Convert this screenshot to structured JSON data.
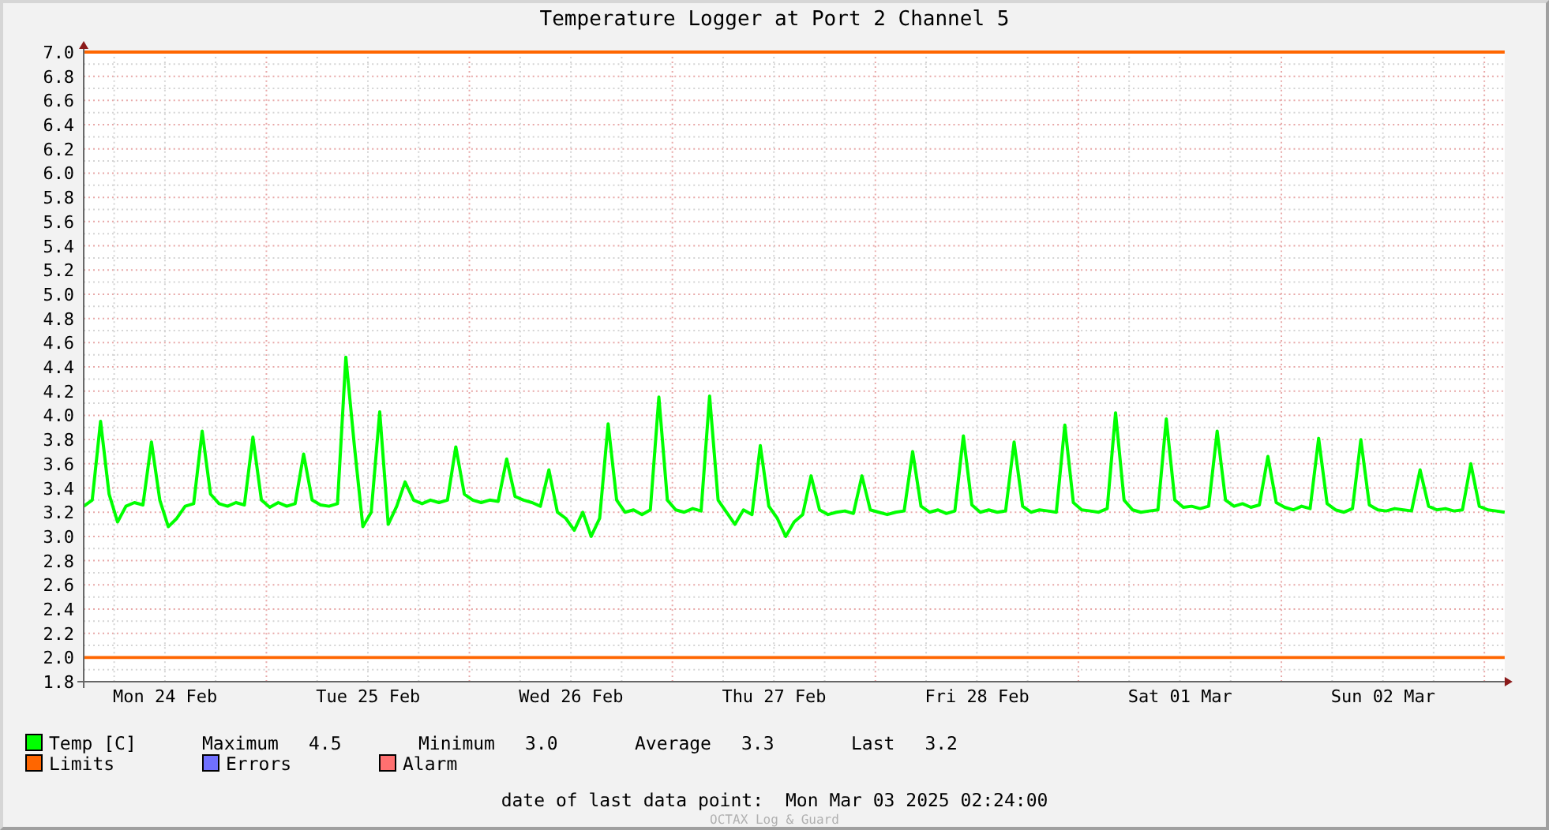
{
  "title": "Temperature Logger at Port 2 Channel 5",
  "chart_data": {
    "type": "line",
    "grid": true,
    "ylim": [
      1.8,
      7.0
    ],
    "categories": [
      null,
      null,
      null,
      null,
      null,
      null,
      null,
      null,
      null,
      null,
      "Mon 24 Feb",
      null,
      null,
      null,
      null,
      null,
      null,
      null,
      null,
      null,
      null,
      null,
      null,
      null,
      null,
      null,
      null,
      null,
      null,
      null,
      null,
      null,
      null,
      null,
      "Tue 25 Feb",
      null,
      null,
      null,
      null,
      null,
      null,
      null,
      null,
      null,
      null,
      null,
      null,
      null,
      null,
      null,
      null,
      null,
      null,
      null,
      null,
      null,
      null,
      null,
      "Wed 26 Feb",
      null,
      null,
      null,
      null,
      null,
      null,
      null,
      null,
      null,
      null,
      null,
      null,
      null,
      null,
      null,
      null,
      null,
      null,
      null,
      null,
      null,
      null,
      null,
      "Thu 27 Feb",
      null,
      null,
      null,
      null,
      null,
      null,
      null,
      null,
      null,
      null,
      null,
      null,
      null,
      null,
      null,
      null,
      null,
      null,
      null,
      null,
      null,
      null,
      null,
      "Fri 28 Feb",
      null,
      null,
      null,
      null,
      null,
      null,
      null,
      null,
      null,
      null,
      null,
      null,
      null,
      null,
      null,
      null,
      null,
      null,
      null,
      null,
      null,
      null,
      null,
      "Sat 01 Mar",
      null,
      null,
      null,
      null,
      null,
      null,
      null,
      null,
      null,
      null,
      null,
      null,
      null,
      null,
      null,
      null,
      null,
      null,
      null,
      null,
      null,
      null,
      null,
      "Sun 02 Mar",
      null,
      null,
      null,
      null,
      null,
      null,
      null,
      null,
      null,
      null,
      null,
      null,
      null,
      null
    ],
    "yticks": [
      {
        "value": 1.8,
        "label": "1.8"
      },
      {
        "value": 2.0,
        "label": "2.0"
      },
      {
        "value": 2.2,
        "label": "2.2"
      },
      {
        "value": 2.4,
        "label": "2.4"
      },
      {
        "value": 2.6,
        "label": "2.6"
      },
      {
        "value": 2.8,
        "label": "2.8"
      },
      {
        "value": 3.0,
        "label": "3.0"
      },
      {
        "value": 3.2,
        "label": "3.2"
      },
      {
        "value": 3.4,
        "label": "3.4"
      },
      {
        "value": 3.6,
        "label": "3.6"
      },
      {
        "value": 3.8,
        "label": "3.8"
      },
      {
        "value": 4.0,
        "label": "4.0"
      },
      {
        "value": 4.2,
        "label": "4.2"
      },
      {
        "value": 4.4,
        "label": "4.4"
      },
      {
        "value": 4.6,
        "label": "4.6"
      },
      {
        "value": 4.8,
        "label": "4.8"
      },
      {
        "value": 5.0,
        "label": "5.0"
      },
      {
        "value": 5.2,
        "label": "5.2"
      },
      {
        "value": 5.4,
        "label": "5.4"
      },
      {
        "value": 5.6,
        "label": "5.6"
      },
      {
        "value": 5.8,
        "label": "5.8"
      },
      {
        "value": 6.0,
        "label": "6.0"
      },
      {
        "value": 6.2,
        "label": "6.2"
      },
      {
        "value": 6.4,
        "label": "6.4"
      },
      {
        "value": 6.6,
        "label": "6.6"
      },
      {
        "value": 6.8,
        "label": "6.8"
      },
      {
        "value": 7.0,
        "label": "7.0"
      }
    ],
    "series": [
      {
        "name": "Temp [C]",
        "color": "#00ff00",
        "values": [
          3.25,
          3.3,
          3.95,
          3.35,
          3.12,
          3.25,
          3.28,
          3.26,
          3.78,
          3.3,
          3.08,
          3.15,
          3.25,
          3.27,
          3.87,
          3.35,
          3.27,
          3.25,
          3.28,
          3.26,
          3.82,
          3.3,
          3.24,
          3.28,
          3.25,
          3.27,
          3.68,
          3.3,
          3.26,
          3.25,
          3.27,
          4.48,
          3.75,
          3.08,
          3.2,
          4.03,
          3.1,
          3.25,
          3.45,
          3.3,
          3.27,
          3.3,
          3.28,
          3.3,
          3.74,
          3.35,
          3.3,
          3.28,
          3.3,
          3.29,
          3.64,
          3.33,
          3.3,
          3.28,
          3.25,
          3.55,
          3.2,
          3.15,
          3.05,
          3.2,
          3.0,
          3.15,
          3.93,
          3.3,
          3.2,
          3.22,
          3.18,
          3.22,
          4.15,
          3.3,
          3.22,
          3.2,
          3.23,
          3.21,
          4.16,
          3.3,
          3.2,
          3.1,
          3.22,
          3.18,
          3.75,
          3.25,
          3.15,
          3.0,
          3.12,
          3.18,
          3.5,
          3.22,
          3.18,
          3.2,
          3.21,
          3.19,
          3.5,
          3.22,
          3.2,
          3.18,
          3.2,
          3.21,
          3.7,
          3.25,
          3.2,
          3.22,
          3.19,
          3.21,
          3.83,
          3.26,
          3.2,
          3.22,
          3.2,
          3.21,
          3.78,
          3.25,
          3.2,
          3.22,
          3.21,
          3.2,
          3.92,
          3.28,
          3.22,
          3.21,
          3.2,
          3.23,
          4.02,
          3.3,
          3.22,
          3.2,
          3.21,
          3.22,
          3.97,
          3.3,
          3.24,
          3.25,
          3.23,
          3.25,
          3.87,
          3.3,
          3.25,
          3.27,
          3.24,
          3.26,
          3.66,
          3.28,
          3.24,
          3.22,
          3.25,
          3.23,
          3.81,
          3.27,
          3.22,
          3.2,
          3.23,
          3.8,
          3.26,
          3.22,
          3.21,
          3.23,
          3.22,
          3.21,
          3.55,
          3.25,
          3.22,
          3.23,
          3.21,
          3.22,
          3.6,
          3.25,
          3.22,
          3.21,
          3.2
        ]
      },
      {
        "name": "Limits",
        "color": "#ff6600",
        "values": [
          7,
          7,
          7,
          7,
          7,
          7,
          7,
          7,
          7,
          7,
          7,
          7,
          7,
          7,
          7,
          7,
          7,
          7,
          7,
          7,
          7,
          7,
          7,
          7,
          7,
          7,
          7,
          7,
          7,
          7,
          7,
          7,
          7,
          7,
          7,
          7,
          7,
          7,
          7,
          7,
          7,
          7,
          7,
          7,
          7,
          7,
          7,
          7,
          7,
          7,
          7,
          7,
          7,
          7,
          7,
          7,
          7,
          7,
          7,
          7,
          7,
          7,
          7,
          7,
          7,
          7,
          7,
          7,
          7,
          7,
          7,
          7,
          7,
          7,
          7,
          7,
          7,
          7,
          7,
          7,
          7,
          7,
          7,
          7,
          7,
          7,
          7,
          7,
          7,
          7,
          7,
          7,
          7,
          7,
          7,
          7,
          7,
          7,
          7,
          7,
          7,
          7,
          7,
          7,
          7,
          7,
          7,
          7,
          7,
          7,
          7,
          7,
          7,
          7,
          7,
          7,
          7,
          7,
          7,
          7,
          7,
          7,
          7,
          7,
          7,
          7,
          7,
          7,
          7,
          7,
          7,
          7,
          7,
          7,
          7,
          7,
          7,
          7,
          7,
          7,
          7,
          7,
          7,
          7,
          7,
          7,
          7,
          7,
          7,
          7,
          7,
          7,
          7,
          7,
          7,
          7,
          7,
          7,
          7,
          7,
          7,
          7,
          7,
          7,
          7,
          7,
          7,
          7,
          7
        ]
      },
      {
        "color": "#ff6600",
        "values": [
          2,
          2,
          2,
          2,
          2,
          2,
          2,
          2,
          2,
          2,
          2,
          2,
          2,
          2,
          2,
          2,
          2,
          2,
          2,
          2,
          2,
          2,
          2,
          2,
          2,
          2,
          2,
          2,
          2,
          2,
          2,
          2,
          2,
          2,
          2,
          2,
          2,
          2,
          2,
          2,
          2,
          2,
          2,
          2,
          2,
          2,
          2,
          2,
          2,
          2,
          2,
          2,
          2,
          2,
          2,
          2,
          2,
          2,
          2,
          2,
          2,
          2,
          2,
          2,
          2,
          2,
          2,
          2,
          2,
          2,
          2,
          2,
          2,
          2,
          2,
          2,
          2,
          2,
          2,
          2,
          2,
          2,
          2,
          2,
          2,
          2,
          2,
          2,
          2,
          2,
          2,
          2,
          2,
          2,
          2,
          2,
          2,
          2,
          2,
          2,
          2,
          2,
          2,
          2,
          2,
          2,
          2,
          2,
          2,
          2,
          2,
          2,
          2,
          2,
          2,
          2,
          2,
          2,
          2,
          2,
          2,
          2,
          2,
          2,
          2,
          2,
          2,
          2,
          2,
          2,
          2,
          2,
          2,
          2,
          2,
          2,
          2,
          2,
          2,
          2,
          2,
          2,
          2,
          2,
          2,
          2,
          2,
          2,
          2,
          2,
          2,
          2,
          2,
          2,
          2,
          2,
          2,
          2,
          2,
          2,
          2,
          2,
          2,
          2,
          2,
          2,
          2,
          2,
          2
        ]
      }
    ]
  },
  "legend": [
    {
      "label": "Errors",
      "color": "#7070ff"
    },
    {
      "label": "Alarm",
      "color": "#ff7070"
    }
  ],
  "stats": [
    {
      "label": "Maximum",
      "value": "4.5"
    },
    {
      "label": "Minimum",
      "value": "3.0"
    },
    {
      "label": "Average",
      "value": "3.3"
    },
    {
      "label": "Last",
      "value": "3.2"
    }
  ],
  "footer": {
    "label": "date of last data point:",
    "value": "Mon Mar 03 2025 02:24:00"
  },
  "credit": "OCTAX Log & Guard"
}
